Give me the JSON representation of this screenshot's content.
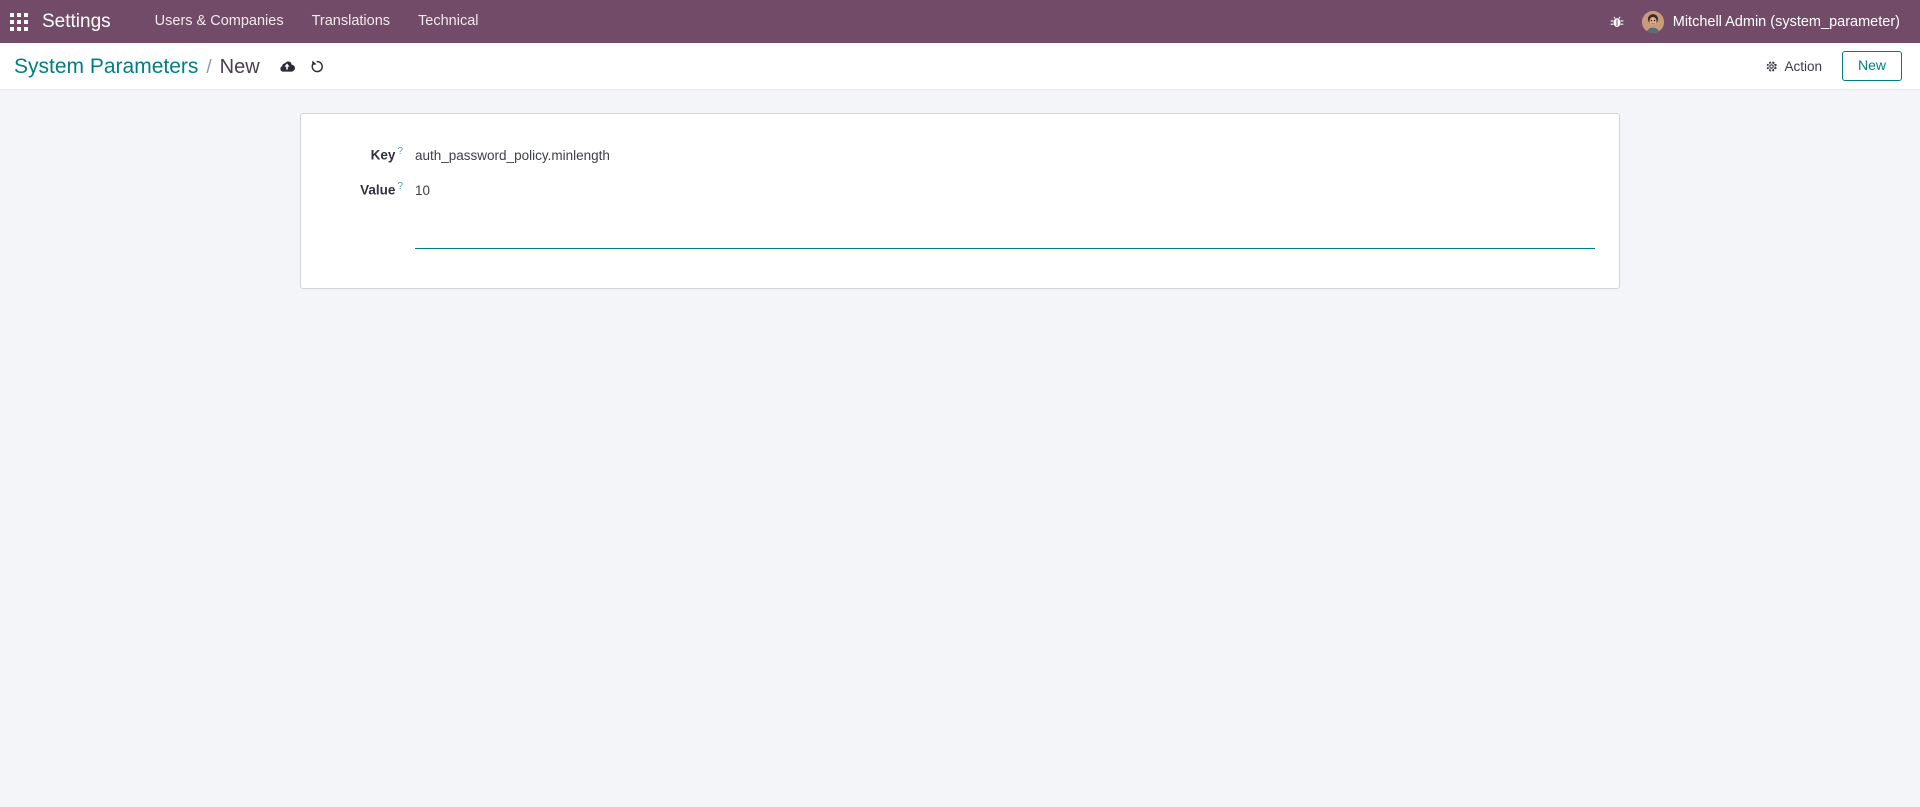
{
  "navbar": {
    "apps_icon": "apps-grid-icon",
    "brand": "Settings",
    "menu_items": [
      {
        "label": "Users & Companies"
      },
      {
        "label": "Translations"
      },
      {
        "label": "Technical"
      }
    ],
    "debug_icon": "bug-icon",
    "user": {
      "name": "Mitchell Admin (system_parameter)",
      "avatar_icon": "user-avatar"
    },
    "background_color": "#714B67"
  },
  "control_panel": {
    "breadcrumb": {
      "root": "System Parameters",
      "separator": "/",
      "current": "New"
    },
    "save_icon": "cloud-upload-icon",
    "discard_icon": "undo-icon",
    "action_label": "Action",
    "action_icon": "gear-icon",
    "new_label": "New",
    "accent_color": "#017E84"
  },
  "form": {
    "fields": [
      {
        "label": "Key",
        "tooltip_marker": "?",
        "value": "auth_password_policy.minlength",
        "placeholder": ""
      },
      {
        "label": "Value",
        "tooltip_marker": "?",
        "value": "10",
        "placeholder": ""
      }
    ]
  }
}
